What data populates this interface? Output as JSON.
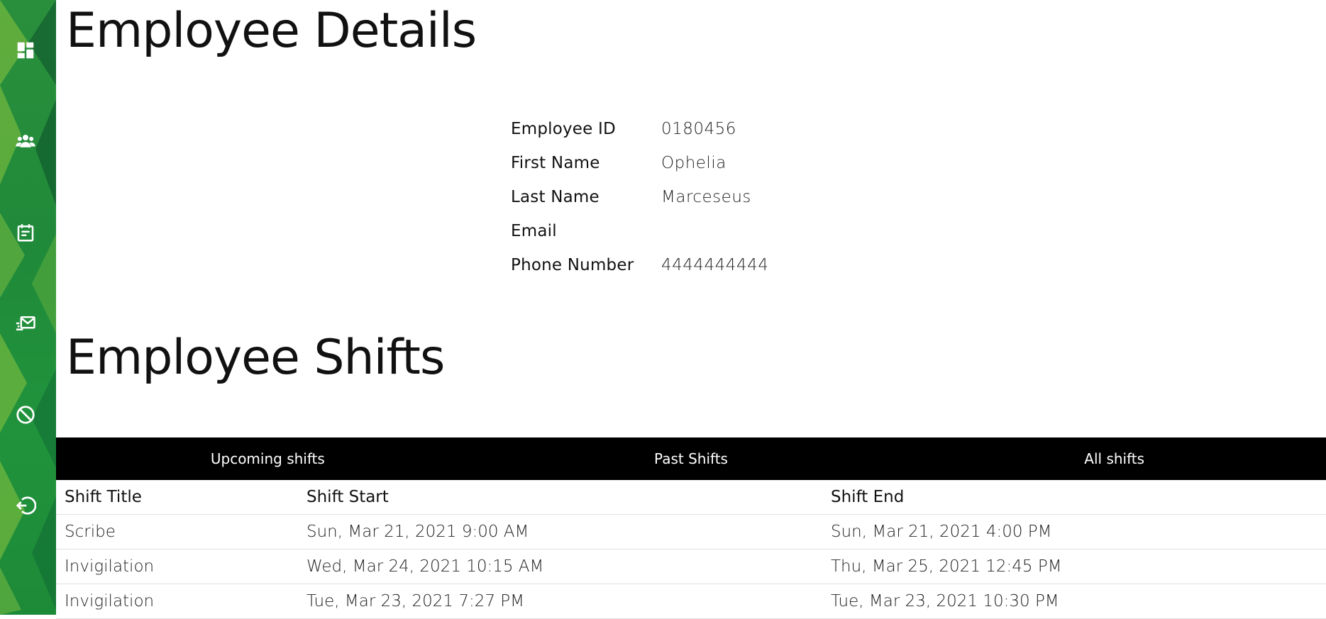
{
  "colors": {
    "sidebar": "#1f8a3a",
    "tab_bar": "#000000",
    "text": "#111111"
  },
  "sidebar": {
    "items": [
      {
        "icon": "dashboard-icon"
      },
      {
        "icon": "employees-icon"
      },
      {
        "icon": "calendar-icon"
      },
      {
        "icon": "mail-icon"
      },
      {
        "icon": "block-icon"
      },
      {
        "icon": "logout-icon"
      }
    ]
  },
  "details": {
    "title": "Employee Details",
    "fields": [
      {
        "label": "Employee ID",
        "value": "0180456"
      },
      {
        "label": "First Name",
        "value": "Ophelia"
      },
      {
        "label": "Last Name",
        "value": "Marceseus"
      },
      {
        "label": "Email",
        "value": ""
      },
      {
        "label": "Phone Number",
        "value": "4444444444"
      }
    ]
  },
  "shifts": {
    "title": "Employee Shifts",
    "tabs": [
      {
        "label": "Upcoming shifts"
      },
      {
        "label": "Past Shifts"
      },
      {
        "label": "All shifts"
      }
    ],
    "columns": [
      "Shift Title",
      "Shift Start",
      "Shift End"
    ],
    "rows": [
      [
        "Scribe",
        "Sun, Mar 21, 2021 9:00 AM",
        "Sun, Mar 21, 2021 4:00 PM"
      ],
      [
        "Invigilation",
        "Wed, Mar 24, 2021 10:15 AM",
        "Thu, Mar 25, 2021 12:45 PM"
      ],
      [
        "Invigilation",
        "Tue, Mar 23, 2021 7:27 PM",
        "Tue, Mar 23, 2021 10:30 PM"
      ]
    ]
  }
}
